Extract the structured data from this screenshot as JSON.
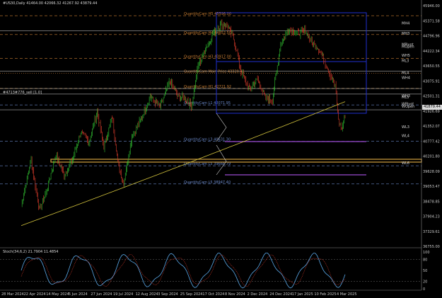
{
  "window": {
    "title": "#US30,Daily  41464.00 42066.32 41267.92 43879.44",
    "stoch_title": "Stoch(34,6,2) 21.7904 11.4854"
  },
  "colors": {
    "background": "#000000",
    "bull": "#32c832",
    "bear": "#e03c2c",
    "ma": "#d2c23c",
    "box": "#1f2fd0",
    "dashed_level": "#c87d32",
    "blue_level": "#6a88c8",
    "purple_level": "#9a4ad0",
    "zone": "#d2a040",
    "stoch_main": "#5aa8e8",
    "stoch_signal": "#e03c2c"
  },
  "levels": [
    {
      "label": "QuantityCam H5  45598.00",
      "price": 45598,
      "color": "#c87d32",
      "style": "dash"
    },
    {
      "label": "QuantityCam H4  44852.50",
      "price": 44852.5,
      "color": "#c87d32",
      "style": "dash"
    },
    {
      "label": "QuantityCam H3  43917.00",
      "price": 43917,
      "color": "#c87d32",
      "style": "dash"
    },
    {
      "label": "QuantityCam Main Price  43320.41",
      "price": 43320.41,
      "color": "#c87d32",
      "style": "dot"
    },
    {
      "label": "QuantityCam H1  42721.92",
      "price": 42721.92,
      "color": "#c87d32",
      "style": "dash"
    },
    {
      "label": "QuantityCam L1  42071.95",
      "price": 42071.95,
      "color": "#6a88c8",
      "style": "dash"
    },
    {
      "label": "QuantityCam L3  40631.30",
      "price": 40631.3,
      "color": "#6a88c8",
      "style": "dash"
    },
    {
      "label": "QuantityCam L5  39666.79",
      "price": 39666.79,
      "color": "#6a88c8",
      "style": "dash"
    },
    {
      "label": "QuantityCam L5  38947.40",
      "price": 38947.4,
      "color": "#6a88c8",
      "style": "dash"
    }
  ],
  "right_labels": [
    {
      "text": "MH4",
      "price": 45250
    },
    {
      "text": "MH3",
      "price": 44850
    },
    {
      "text": "MPivot",
      "price": 44420
    },
    {
      "text": "MOpen",
      "price": 44330
    },
    {
      "text": "WH5",
      "price": 43980
    },
    {
      "text": "ML3",
      "price": 43770
    },
    {
      "text": "WH4",
      "price": 43100
    },
    {
      "text": "ML4",
      "price": 43300
    },
    {
      "text": "WH3",
      "price": 42380
    },
    {
      "text": "ML5",
      "price": 42330
    },
    {
      "text": "WPivot",
      "price": 42060
    },
    {
      "text": "WOpen",
      "price": 41960
    },
    {
      "text": "WL3",
      "price": 41150
    },
    {
      "text": "WL4",
      "price": 40800
    },
    {
      "text": "WL6",
      "price": 39720
    }
  ],
  "left_line_label": "#4713#776_sell  [1.0]",
  "price_axis": [
    "45946.00",
    "45371.58",
    "44796.96",
    "44222.34",
    "43650.55",
    "43075.91",
    "42501.31",
    "41926.69",
    "41352.07",
    "40777.42",
    "40201.80",
    "39628.09",
    "39053.47",
    "38478.85",
    "37904.23",
    "37329.61",
    "36755.00"
  ],
  "current_price": "41879.44",
  "stoch_axis": [
    "100",
    "80",
    "50",
    "20",
    "0"
  ],
  "time_axis": [
    "28 Mar 2024",
    "22 Apr 2024",
    "14 May 2024",
    "5 Jun 2024",
    "27 Jun 2024",
    "19 Jul 2024",
    "12 Aug 2024",
    "3 Sep 2024",
    "25 Sep 2024",
    "17 Oct 2024",
    "8 Nov 2024",
    "2 Dec 2024",
    "24 Dec 2024",
    "17 Jan 2025",
    "10 Feb 2025",
    "4 Mar 2025"
  ]
}
